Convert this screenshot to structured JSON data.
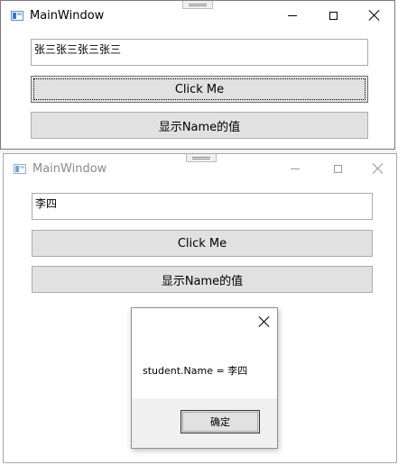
{
  "window1": {
    "title": "MainWindow",
    "name_textbox_value": "张三张三张三张三",
    "click_button_label": "Click Me",
    "show_button_label": "显示Name的值"
  },
  "window2": {
    "title": "MainWindow",
    "name_textbox_value": "李四",
    "click_button_label": "Click Me",
    "show_button_label": "显示Name的值"
  },
  "message_box": {
    "text": "student.Name = 李四",
    "ok_label": "确定"
  },
  "icons": [
    "app-icon",
    "minimize-icon",
    "maximize-icon",
    "close-icon"
  ],
  "colors": {
    "button_face": "#e1e1e1",
    "border": "#adadad",
    "inactive_title": "#8a8a8a"
  }
}
